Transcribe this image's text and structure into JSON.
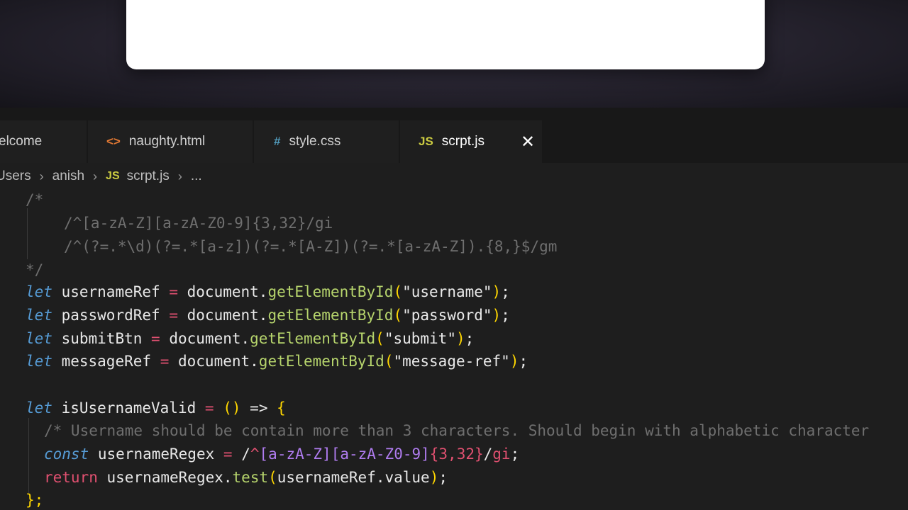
{
  "tabs": [
    {
      "label": "elcome",
      "icon": "",
      "active": false
    },
    {
      "label": "naughty.html",
      "icon": "<>",
      "active": false
    },
    {
      "label": "style.css",
      "icon": "#",
      "active": false
    },
    {
      "label": "scrpt.js",
      "icon": "JS",
      "active": true
    }
  ],
  "close_icon": "✕",
  "breadcrumb": {
    "items": [
      "Users",
      "anish",
      "scrpt.js",
      "..."
    ],
    "file_icon": "JS"
  },
  "code": {
    "comment_open": "/*",
    "comment_line1": "/^[a-zA-Z][a-zA-Z0-9]{3,32}/gi",
    "comment_line2": "/^(?=.*\\d)(?=.*[a-z])(?=.*[A-Z])(?=.*[a-zA-Z]).{8,}$/gm",
    "comment_close": "*/",
    "decls": [
      {
        "kw": "let",
        "name": "usernameRef",
        "obj": "document.",
        "fn": "getElementById",
        "arg": "\"username\""
      },
      {
        "kw": "let",
        "name": "passwordRef",
        "obj": "document.",
        "fn": "getElementById",
        "arg": "\"password\""
      },
      {
        "kw": "let",
        "name": "submitBtn",
        "obj": "document.",
        "fn": "getElementById",
        "arg": "\"submit\""
      },
      {
        "kw": "let",
        "name": "messageRef",
        "obj": "document.",
        "fn": "getElementById",
        "arg": "\"message-ref\""
      }
    ],
    "fn_decl": {
      "kw": "let",
      "name": "isUsernameValid",
      "eq": "=",
      "params": "()",
      "arrow": "=>",
      "brace": "{"
    },
    "fn_comment": "/* Username should be contain more than 3 characters. Should begin with alphabetic character",
    "const_line": {
      "kw": "const",
      "name": "usernameRegex",
      "eq": "=",
      "slash": "/",
      "caret": "^",
      "rx1": "[a-zA-Z]",
      "rx2": "[a-zA-Z0-9]",
      "quant": "{3,32}",
      "close": "/",
      "flags": "gi",
      "semi": ";"
    },
    "return_line": {
      "kw": "return",
      "expr": "usernameRegex.",
      "fn": "test",
      "arg": "usernameRef.value",
      "semi": ";"
    },
    "fn_close": "};"
  }
}
